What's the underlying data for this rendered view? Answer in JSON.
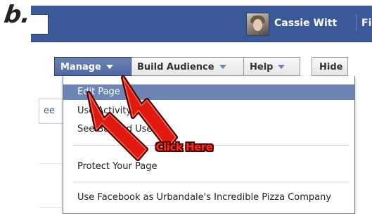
{
  "step_label": "b.",
  "topbar": {
    "user_name": "Cassie Witt",
    "find_link": "Find"
  },
  "toolbar": {
    "manage_label": "Manage",
    "build_audience_label": "Build Audience",
    "help_label": "Help",
    "hide_label": "Hide"
  },
  "menu": {
    "items": [
      "Edit Page",
      "Use Activity Log",
      "See Banned Users...",
      "Protect Your Page",
      "Use Facebook as Urbandale's Incredible Pizza Company"
    ]
  },
  "side_fragment": "ee",
  "annotation": {
    "callout_text": "Click Here"
  },
  "colors": {
    "facebook_blue": "#3b5998",
    "menu_highlight": "#6d84b4",
    "arrow_red": "#e01a10",
    "arrow_outline": "#4a0000"
  }
}
